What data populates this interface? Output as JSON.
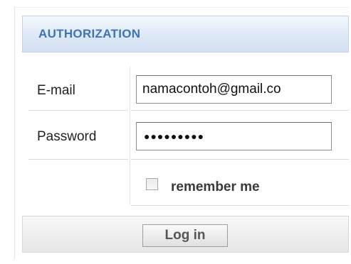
{
  "panel": {
    "title": "AUTHORIZATION"
  },
  "form": {
    "email": {
      "label": "E-mail",
      "value": "namacontoh@gmail.co"
    },
    "password": {
      "label": "Password",
      "masked_value": "●●●●●●●●●"
    },
    "remember": {
      "label": "remember me",
      "checked": false
    },
    "submit_label": "Log in"
  },
  "colors": {
    "header_text": "#3f73b4",
    "header_bg": "#dde8f6"
  }
}
